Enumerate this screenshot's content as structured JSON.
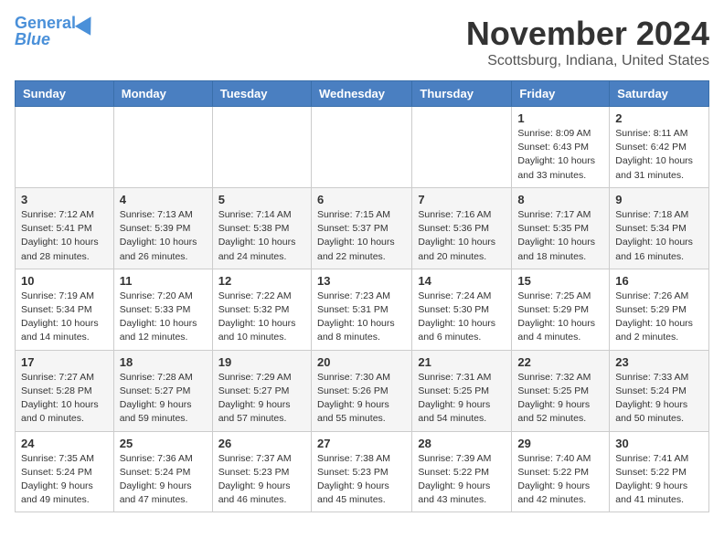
{
  "header": {
    "logo_line1": "General",
    "logo_line2": "Blue",
    "title": "November 2024",
    "subtitle": "Scottsburg, Indiana, United States"
  },
  "days_of_week": [
    "Sunday",
    "Monday",
    "Tuesday",
    "Wednesday",
    "Thursday",
    "Friday",
    "Saturday"
  ],
  "weeks": [
    [
      {
        "day": "",
        "info": ""
      },
      {
        "day": "",
        "info": ""
      },
      {
        "day": "",
        "info": ""
      },
      {
        "day": "",
        "info": ""
      },
      {
        "day": "",
        "info": ""
      },
      {
        "day": "1",
        "info": "Sunrise: 8:09 AM\nSunset: 6:43 PM\nDaylight: 10 hours and 33 minutes."
      },
      {
        "day": "2",
        "info": "Sunrise: 8:11 AM\nSunset: 6:42 PM\nDaylight: 10 hours and 31 minutes."
      }
    ],
    [
      {
        "day": "3",
        "info": "Sunrise: 7:12 AM\nSunset: 5:41 PM\nDaylight: 10 hours and 28 minutes."
      },
      {
        "day": "4",
        "info": "Sunrise: 7:13 AM\nSunset: 5:39 PM\nDaylight: 10 hours and 26 minutes."
      },
      {
        "day": "5",
        "info": "Sunrise: 7:14 AM\nSunset: 5:38 PM\nDaylight: 10 hours and 24 minutes."
      },
      {
        "day": "6",
        "info": "Sunrise: 7:15 AM\nSunset: 5:37 PM\nDaylight: 10 hours and 22 minutes."
      },
      {
        "day": "7",
        "info": "Sunrise: 7:16 AM\nSunset: 5:36 PM\nDaylight: 10 hours and 20 minutes."
      },
      {
        "day": "8",
        "info": "Sunrise: 7:17 AM\nSunset: 5:35 PM\nDaylight: 10 hours and 18 minutes."
      },
      {
        "day": "9",
        "info": "Sunrise: 7:18 AM\nSunset: 5:34 PM\nDaylight: 10 hours and 16 minutes."
      }
    ],
    [
      {
        "day": "10",
        "info": "Sunrise: 7:19 AM\nSunset: 5:34 PM\nDaylight: 10 hours and 14 minutes."
      },
      {
        "day": "11",
        "info": "Sunrise: 7:20 AM\nSunset: 5:33 PM\nDaylight: 10 hours and 12 minutes."
      },
      {
        "day": "12",
        "info": "Sunrise: 7:22 AM\nSunset: 5:32 PM\nDaylight: 10 hours and 10 minutes."
      },
      {
        "day": "13",
        "info": "Sunrise: 7:23 AM\nSunset: 5:31 PM\nDaylight: 10 hours and 8 minutes."
      },
      {
        "day": "14",
        "info": "Sunrise: 7:24 AM\nSunset: 5:30 PM\nDaylight: 10 hours and 6 minutes."
      },
      {
        "day": "15",
        "info": "Sunrise: 7:25 AM\nSunset: 5:29 PM\nDaylight: 10 hours and 4 minutes."
      },
      {
        "day": "16",
        "info": "Sunrise: 7:26 AM\nSunset: 5:29 PM\nDaylight: 10 hours and 2 minutes."
      }
    ],
    [
      {
        "day": "17",
        "info": "Sunrise: 7:27 AM\nSunset: 5:28 PM\nDaylight: 10 hours and 0 minutes."
      },
      {
        "day": "18",
        "info": "Sunrise: 7:28 AM\nSunset: 5:27 PM\nDaylight: 9 hours and 59 minutes."
      },
      {
        "day": "19",
        "info": "Sunrise: 7:29 AM\nSunset: 5:27 PM\nDaylight: 9 hours and 57 minutes."
      },
      {
        "day": "20",
        "info": "Sunrise: 7:30 AM\nSunset: 5:26 PM\nDaylight: 9 hours and 55 minutes."
      },
      {
        "day": "21",
        "info": "Sunrise: 7:31 AM\nSunset: 5:25 PM\nDaylight: 9 hours and 54 minutes."
      },
      {
        "day": "22",
        "info": "Sunrise: 7:32 AM\nSunset: 5:25 PM\nDaylight: 9 hours and 52 minutes."
      },
      {
        "day": "23",
        "info": "Sunrise: 7:33 AM\nSunset: 5:24 PM\nDaylight: 9 hours and 50 minutes."
      }
    ],
    [
      {
        "day": "24",
        "info": "Sunrise: 7:35 AM\nSunset: 5:24 PM\nDaylight: 9 hours and 49 minutes."
      },
      {
        "day": "25",
        "info": "Sunrise: 7:36 AM\nSunset: 5:24 PM\nDaylight: 9 hours and 47 minutes."
      },
      {
        "day": "26",
        "info": "Sunrise: 7:37 AM\nSunset: 5:23 PM\nDaylight: 9 hours and 46 minutes."
      },
      {
        "day": "27",
        "info": "Sunrise: 7:38 AM\nSunset: 5:23 PM\nDaylight: 9 hours and 45 minutes."
      },
      {
        "day": "28",
        "info": "Sunrise: 7:39 AM\nSunset: 5:22 PM\nDaylight: 9 hours and 43 minutes."
      },
      {
        "day": "29",
        "info": "Sunrise: 7:40 AM\nSunset: 5:22 PM\nDaylight: 9 hours and 42 minutes."
      },
      {
        "day": "30",
        "info": "Sunrise: 7:41 AM\nSunset: 5:22 PM\nDaylight: 9 hours and 41 minutes."
      }
    ]
  ]
}
